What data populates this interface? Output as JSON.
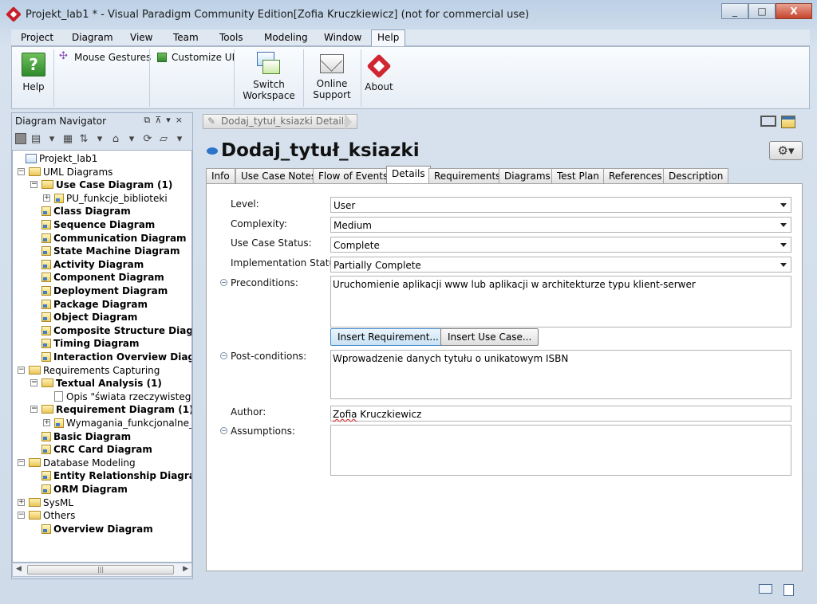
{
  "window": {
    "title": "Projekt_lab1 * - Visual Paradigm Community Edition[Zofia Kruczkiewicz] (not for commercial use)",
    "buttons": [
      "_",
      "□",
      "X"
    ]
  },
  "menu": [
    "Project",
    "Diagram",
    "View",
    "Team",
    "Tools",
    "Modeling",
    "Window",
    "Help"
  ],
  "ribbon": {
    "help": "Help",
    "mouse_gestures": "Mouse Gestures",
    "customize_ui": "Customize UI",
    "switch_workspace_1": "Switch",
    "switch_workspace_2": "Workspace",
    "online_support_1": "Online",
    "online_support_2": "Support",
    "about": "About"
  },
  "navigator": {
    "title": "Diagram Navigator",
    "tree": [
      {
        "label": "Projekt_lab1",
        "level": 0,
        "bold": false,
        "icon": "project",
        "exp": ""
      },
      {
        "label": "UML Diagrams",
        "level": 1,
        "bold": false,
        "icon": "folder",
        "exp": "−"
      },
      {
        "label": "Use Case Diagram (1)",
        "level": 2,
        "bold": true,
        "icon": "folder",
        "exp": "−"
      },
      {
        "label": "PU_funkcje_biblioteki",
        "level": 3,
        "bold": false,
        "icon": "diagram",
        "exp": "+"
      },
      {
        "label": "Class Diagram",
        "level": 2,
        "bold": true,
        "icon": "diagram",
        "exp": ""
      },
      {
        "label": "Sequence Diagram",
        "level": 2,
        "bold": true,
        "icon": "diagram",
        "exp": ""
      },
      {
        "label": "Communication Diagram",
        "level": 2,
        "bold": true,
        "icon": "diagram",
        "exp": ""
      },
      {
        "label": "State Machine Diagram",
        "level": 2,
        "bold": true,
        "icon": "diagram",
        "exp": ""
      },
      {
        "label": "Activity Diagram",
        "level": 2,
        "bold": true,
        "icon": "diagram",
        "exp": ""
      },
      {
        "label": "Component Diagram",
        "level": 2,
        "bold": true,
        "icon": "diagram",
        "exp": ""
      },
      {
        "label": "Deployment Diagram",
        "level": 2,
        "bold": true,
        "icon": "diagram",
        "exp": ""
      },
      {
        "label": "Package Diagram",
        "level": 2,
        "bold": true,
        "icon": "diagram",
        "exp": ""
      },
      {
        "label": "Object Diagram",
        "level": 2,
        "bold": true,
        "icon": "diagram",
        "exp": ""
      },
      {
        "label": "Composite Structure Diagram",
        "level": 2,
        "bold": true,
        "icon": "diagram",
        "exp": ""
      },
      {
        "label": "Timing Diagram",
        "level": 2,
        "bold": true,
        "icon": "diagram",
        "exp": ""
      },
      {
        "label": "Interaction Overview Diagram",
        "level": 2,
        "bold": true,
        "icon": "diagram",
        "exp": ""
      },
      {
        "label": "Requirements Capturing",
        "level": 1,
        "bold": false,
        "icon": "folder",
        "exp": "−"
      },
      {
        "label": "Textual Analysis (1)",
        "level": 2,
        "bold": true,
        "icon": "folder",
        "exp": "−"
      },
      {
        "label": "Opis \"świata rzeczywistego\"",
        "level": 3,
        "bold": false,
        "icon": "doc",
        "exp": ""
      },
      {
        "label": "Requirement Diagram (1)",
        "level": 2,
        "bold": true,
        "icon": "folder",
        "exp": "−"
      },
      {
        "label": "Wymagania_funkcjonalne_i_niefunkcjonalne",
        "level": 3,
        "bold": false,
        "icon": "diagram",
        "exp": "+"
      },
      {
        "label": "Basic Diagram",
        "level": 2,
        "bold": true,
        "icon": "diagram",
        "exp": ""
      },
      {
        "label": "CRC Card Diagram",
        "level": 2,
        "bold": true,
        "icon": "diagram",
        "exp": ""
      },
      {
        "label": "Database Modeling",
        "level": 1,
        "bold": false,
        "icon": "folder",
        "exp": "−"
      },
      {
        "label": "Entity Relationship Diagram",
        "level": 2,
        "bold": true,
        "icon": "diagram",
        "exp": ""
      },
      {
        "label": "ORM Diagram",
        "level": 2,
        "bold": true,
        "icon": "diagram",
        "exp": ""
      },
      {
        "label": "SysML",
        "level": 1,
        "bold": false,
        "icon": "folder",
        "exp": "+"
      },
      {
        "label": "Others",
        "level": 1,
        "bold": false,
        "icon": "folder",
        "exp": "−"
      },
      {
        "label": "Overview Diagram",
        "level": 2,
        "bold": true,
        "icon": "diagram",
        "exp": ""
      }
    ]
  },
  "details": {
    "breadcrumb": "Dodaj_tytuł_ksiazki Details",
    "title": "Dodaj_tytuł_ksiazki",
    "tabs": [
      "Info",
      "Use Case Notes",
      "Flow of Events",
      "Details",
      "Requirements",
      "Diagrams",
      "Test Plan",
      "References",
      "Description"
    ],
    "active_tab": "Details",
    "level_label": "Level:",
    "level_value": "User",
    "complexity_label": "Complexity:",
    "complexity_value": "Medium",
    "status_label": "Use Case Status:",
    "status_value": "Complete",
    "impl_label": "Implementation Status:",
    "impl_value": "Partially Complete",
    "pre_label": "Preconditions:",
    "pre_value": "Uruchomienie aplikacji www lub aplikacji w architekturze typu klient-serwer",
    "insert_req": "Insert Requirement...",
    "insert_uc": "Insert Use Case...",
    "post_label": "Post-conditions:",
    "post_value": "Wprowadzenie danych tytułu o unikatowym ISBN",
    "author_label": "Author:",
    "author_first": "Zofia",
    "author_last": " Kruczkiewicz",
    "assumptions_label": "Assumptions:"
  }
}
